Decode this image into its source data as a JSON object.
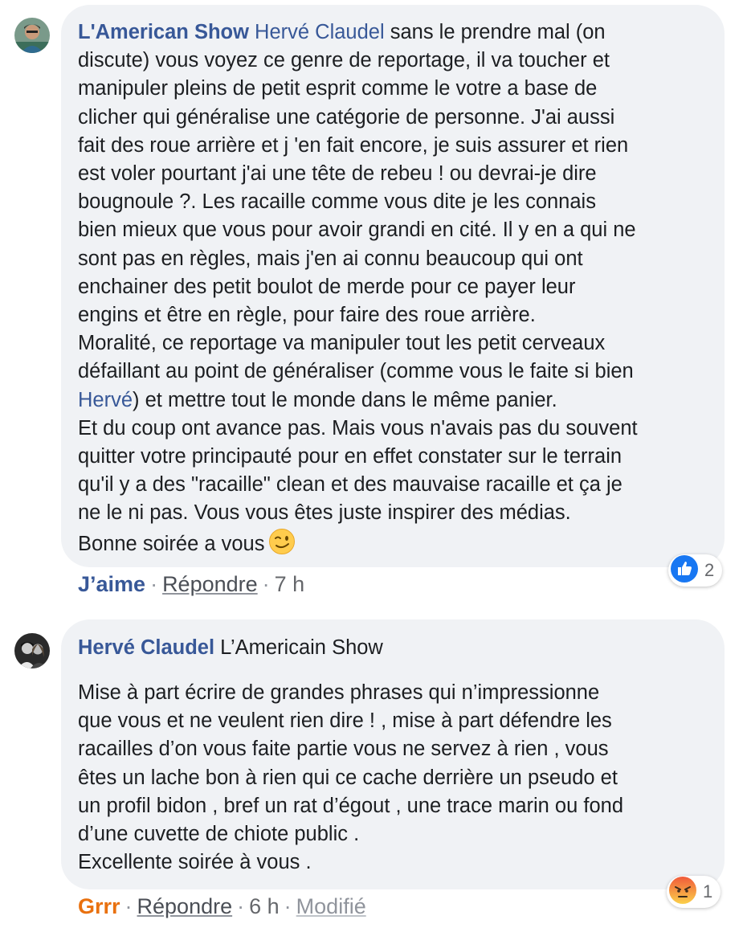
{
  "comments": [
    {
      "author": "L'American Show",
      "mention": "Hervé Claudel",
      "line1_rest": " sans le prendre mal (on",
      "lines_a": [
        "discute) vous voyez ce genre de reportage, il va toucher et",
        "manipuler pleins de petit esprit comme le votre a base de",
        "clicher qui généralise une catégorie de personne. J'ai aussi",
        "fait des roue arrière et j 'en fait encore, je suis assurer et rien",
        "est voler pourtant j'ai une tête de rebeu ! ou devrai-je dire",
        "bougnoule ?. Les racaille comme vous dite je les connais",
        "bien mieux que vous pour avoir grandi en cité. Il y en a qui ne",
        "sont pas en règles, mais j'en ai connu beaucoup qui ont",
        "enchainer des petit boulot de merde pour ce payer leur",
        "engins et être en règle, pour faire des roue arrière.",
        "Moralité, ce reportage va manipuler tout les petit cerveaux",
        "défaillant au point de généraliser (comme vous le faite si bien"
      ],
      "mention2": "Hervé",
      "mention2_rest": ") et mettre tout le monde dans le même panier.",
      "lines_b": [
        "Et du coup ont avance pas. Mais vous n'avais pas du souvent",
        "quitter votre principauté pour en effet constater sur le terrain",
        "qu'il y a des \"racaille\" clean et des mauvaise racaille et ça je",
        "ne le ni pas. Vous vous êtes juste inspirer des médias."
      ],
      "last_line": "Bonne soirée a vous",
      "emoji": "wink-emoji",
      "reaction_label": "J’aime",
      "reply": "Répondre",
      "time": "7 h",
      "reaction_icon": "like-icon",
      "reaction_count": "2"
    },
    {
      "author": "Hervé Claudel",
      "mention": "L’Americain Show",
      "lines": [
        "Mise à part écrire de grandes phrases qui n’impressionne",
        "que vous et ne veulent rien dire ! , mise à part défendre les",
        "racailles d’on vous faite partie vous ne servez à rien , vous",
        "êtes un lache bon à rien qui ce cache derrière un pseudo et",
        "un profil bidon , bref un rat d’égout , une trace marin ou fond",
        "d’une cuvette de chiote public .",
        "Excellente soirée à vous ."
      ],
      "reaction_label": "Grrr",
      "reply": "Répondre",
      "time": "6 h",
      "edited": "Modifié",
      "reaction_icon": "angry-icon",
      "reaction_count": "1"
    }
  ],
  "colors": {
    "bubble": "#f0f2f5",
    "author": "#385898",
    "like": "#385898",
    "grrr": "#e9710f",
    "like_badge": "#1877f2",
    "angry_badge": "#f7714c"
  }
}
